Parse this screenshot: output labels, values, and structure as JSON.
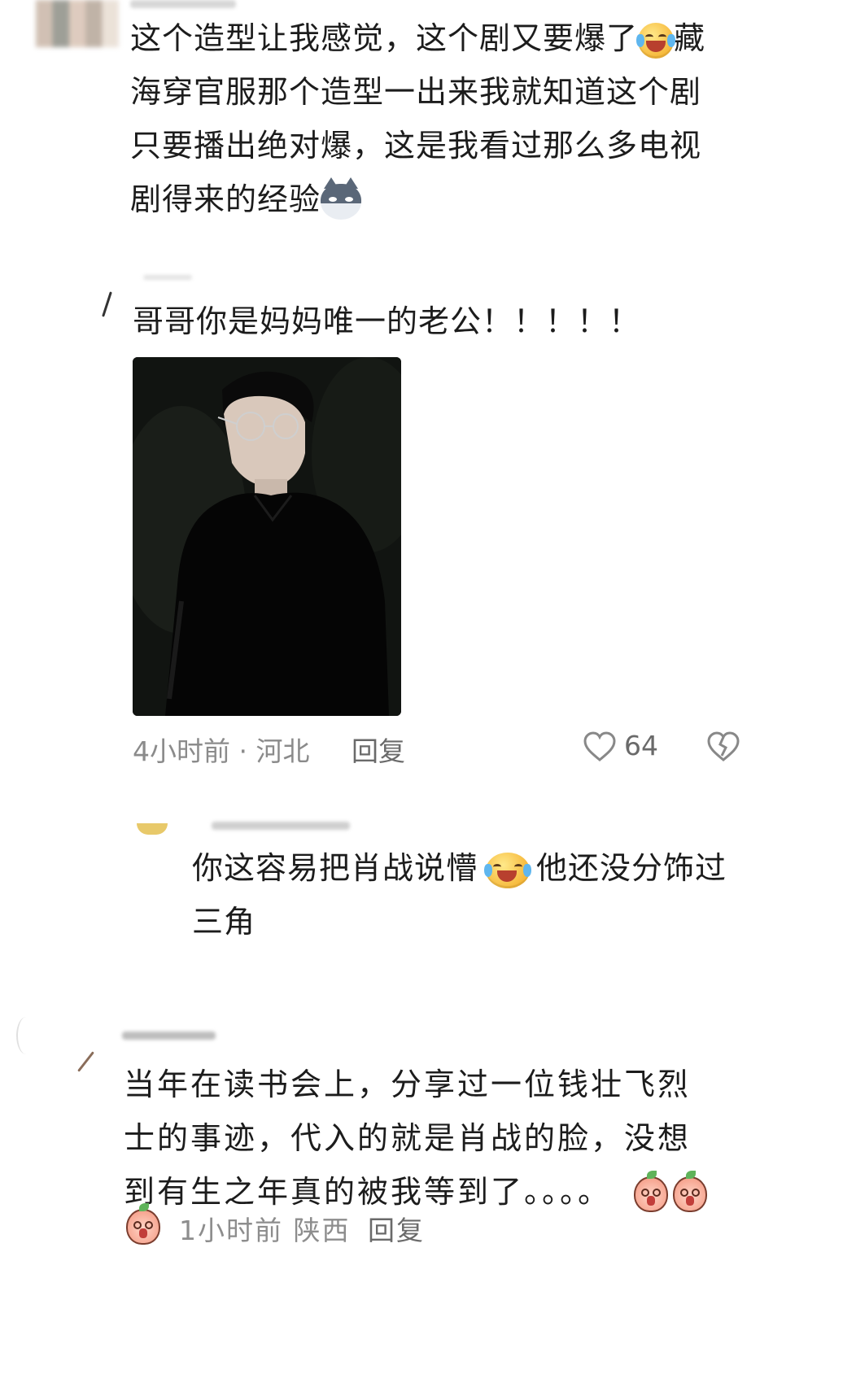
{
  "comments": [
    {
      "text_lines": [
        "这个造型让我感觉，这个剧又要爆了",
        "海穿官服那个造型一出来我就知道这个剧",
        "只要播出绝对爆，这是我看过那么多电视",
        "剧得来的经验"
      ],
      "line1_tail": "藏"
    },
    {
      "text": "哥哥你是妈妈唯一的老公！！！！！",
      "meta_time": "4小时前",
      "meta_sep": "·",
      "meta_location": "河北",
      "reply_label": "回复",
      "like_count": "64"
    },
    {
      "text_part1": "你这容易把肖战说懵",
      "text_part2": "他还没分饰过",
      "text_line2": "三角"
    },
    {
      "text_lines": [
        "当年在读书会上，分享过一位钱壮飞烈",
        "士的事迹，代入的就是肖战的脸，没想",
        "到有生之年真的被我等到了。。。。"
      ],
      "meta_time": "1小时前",
      "meta_location": "陕西",
      "reply_label": "回复"
    }
  ],
  "icons": {
    "crying-laugh": "emoji-laugh-cry-icon",
    "cat": "emoji-sly-cat-icon",
    "peach": "emoji-peach-icon",
    "heart": "heart-icon",
    "broken-heart": "broken-heart-icon"
  }
}
